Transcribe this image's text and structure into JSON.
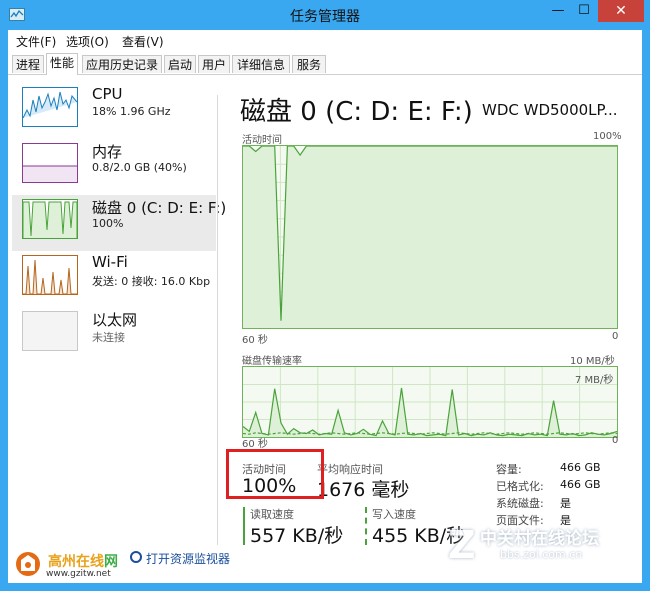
{
  "window": {
    "title": "任务管理器",
    "minimize_glyph": "—",
    "maximize_glyph": "☐",
    "close_glyph": "✕"
  },
  "menu": [
    "文件(F)",
    "选项(O)",
    "查看(V)"
  ],
  "tabs": [
    "进程",
    "性能",
    "应用历史记录",
    "启动",
    "用户",
    "详细信息",
    "服务"
  ],
  "active_tab": "性能",
  "resources": [
    {
      "name": "CPU",
      "detail": "18% 1.96 GHz",
      "color": "#1b7fbe",
      "icon": "cpu-graph-icon"
    },
    {
      "name": "内存",
      "detail": "0.8/2.0 GB (40%)",
      "color": "#8b3a93",
      "icon": "memory-graph-icon"
    },
    {
      "name": "磁盘 0 (C: D: E: F:)",
      "detail": "100%",
      "color": "#4aa33a",
      "icon": "disk-graph-icon"
    },
    {
      "name": "Wi-Fi",
      "detail": "发送: 0 接收: 16.0 Kbp",
      "color": "#b5651d",
      "icon": "wifi-graph-icon"
    },
    {
      "name": "以太网",
      "detail": "未连接",
      "color": "#9a9a9a",
      "icon": "ethernet-graph-icon"
    }
  ],
  "disk": {
    "title": "磁盘 0 (C: D: E: F:)",
    "model": "WDC WD5000LP...",
    "active_time_graph": {
      "label": "活动时间",
      "max_label": "100%",
      "x_left": "60 秒",
      "x_right": "0",
      "values": [
        100,
        100,
        97,
        100,
        100,
        100,
        4,
        100,
        100,
        95,
        100,
        100,
        100,
        100,
        100,
        100,
        100,
        100,
        100,
        100,
        100,
        100,
        100,
        100,
        100,
        100,
        100,
        100,
        100,
        100,
        100,
        100,
        100,
        100,
        100,
        100,
        100,
        100,
        100,
        100,
        100,
        100,
        100,
        100,
        100,
        100,
        100,
        100,
        100,
        100,
        100,
        100,
        100,
        100,
        100,
        100,
        100,
        100,
        100,
        100
      ]
    },
    "transfer_graph": {
      "label": "磁盘传输速率",
      "max_label": "10 MB/秒",
      "mid_label": "7 MB/秒",
      "x_left": "60 秒",
      "x_right": "0",
      "read_values": [
        1.5,
        0.8,
        3.5,
        0.5,
        0.3,
        6.9,
        2.0,
        0.4,
        1.2,
        0.6,
        0.5,
        1.0,
        0.3,
        0.5,
        0.4,
        3.8,
        0.6,
        0.3,
        0.5,
        1.1,
        0.4,
        0.2,
        2.3,
        0.5,
        0.3,
        7.0,
        0.4,
        0.3,
        0.5,
        0.2,
        0.3,
        0.4,
        0.2,
        6.8,
        0.3,
        0.5,
        0.2,
        0.4,
        0.3,
        0.6,
        0.3,
        0.2,
        0.4,
        0.3,
        0.2,
        0.5,
        0.3,
        0.4,
        0.2,
        5.2,
        0.4,
        0.3,
        0.5,
        0.2,
        0.3,
        0.6,
        0.4,
        0.3,
        0.5,
        0.8
      ],
      "write_values": [
        0.5,
        0.4,
        0.6,
        0.5,
        0.4,
        0.5,
        0.6,
        0.5,
        0.4,
        0.5,
        0.6,
        0.5,
        0.4,
        0.5,
        0.6,
        0.5,
        0.4,
        0.5,
        0.6,
        0.5,
        0.4,
        0.5,
        0.6,
        0.5,
        0.4,
        0.5,
        0.6,
        0.5,
        0.4,
        0.5,
        0.6,
        0.5,
        0.4,
        0.5,
        0.6,
        0.5,
        0.4,
        0.5,
        0.6,
        0.5,
        0.4,
        0.5,
        0.6,
        0.5,
        0.4,
        0.5,
        0.6,
        0.5,
        0.4,
        0.5,
        0.6,
        0.5,
        0.4,
        0.5,
        0.6,
        0.5,
        0.4,
        0.5,
        0.6,
        0.5
      ]
    },
    "stats": {
      "active_time_label": "活动时间",
      "active_time_value": "100%",
      "avg_response_label": "平均响应时间",
      "avg_response_value": "1676 毫秒",
      "read_speed_label": "读取速度",
      "read_speed_value": "557 KB/秒",
      "write_speed_label": "写入速度",
      "write_speed_value": "455 KB/秒"
    },
    "properties": [
      {
        "label": "容量:",
        "value": "466 GB"
      },
      {
        "label": "已格式化:",
        "value": "466 GB"
      },
      {
        "label": "系统磁盘:",
        "value": "是"
      },
      {
        "label": "页面文件:",
        "value": "是"
      }
    ]
  },
  "footer": {
    "monitor_link": "打开资源监视器",
    "logo_name": "高州在线",
    "logo_suffix": "网",
    "logo_url": "www.gzitw.net"
  },
  "watermark": {
    "line1": "中关村在线论坛",
    "line2": "bbs.zol.com.cn",
    "z_glyph": "Z"
  },
  "colors": {
    "title_bar": "#39a8f0",
    "close_button": "#c7423b",
    "disk_accent": "#4aa33a",
    "highlight": "#e02020"
  }
}
